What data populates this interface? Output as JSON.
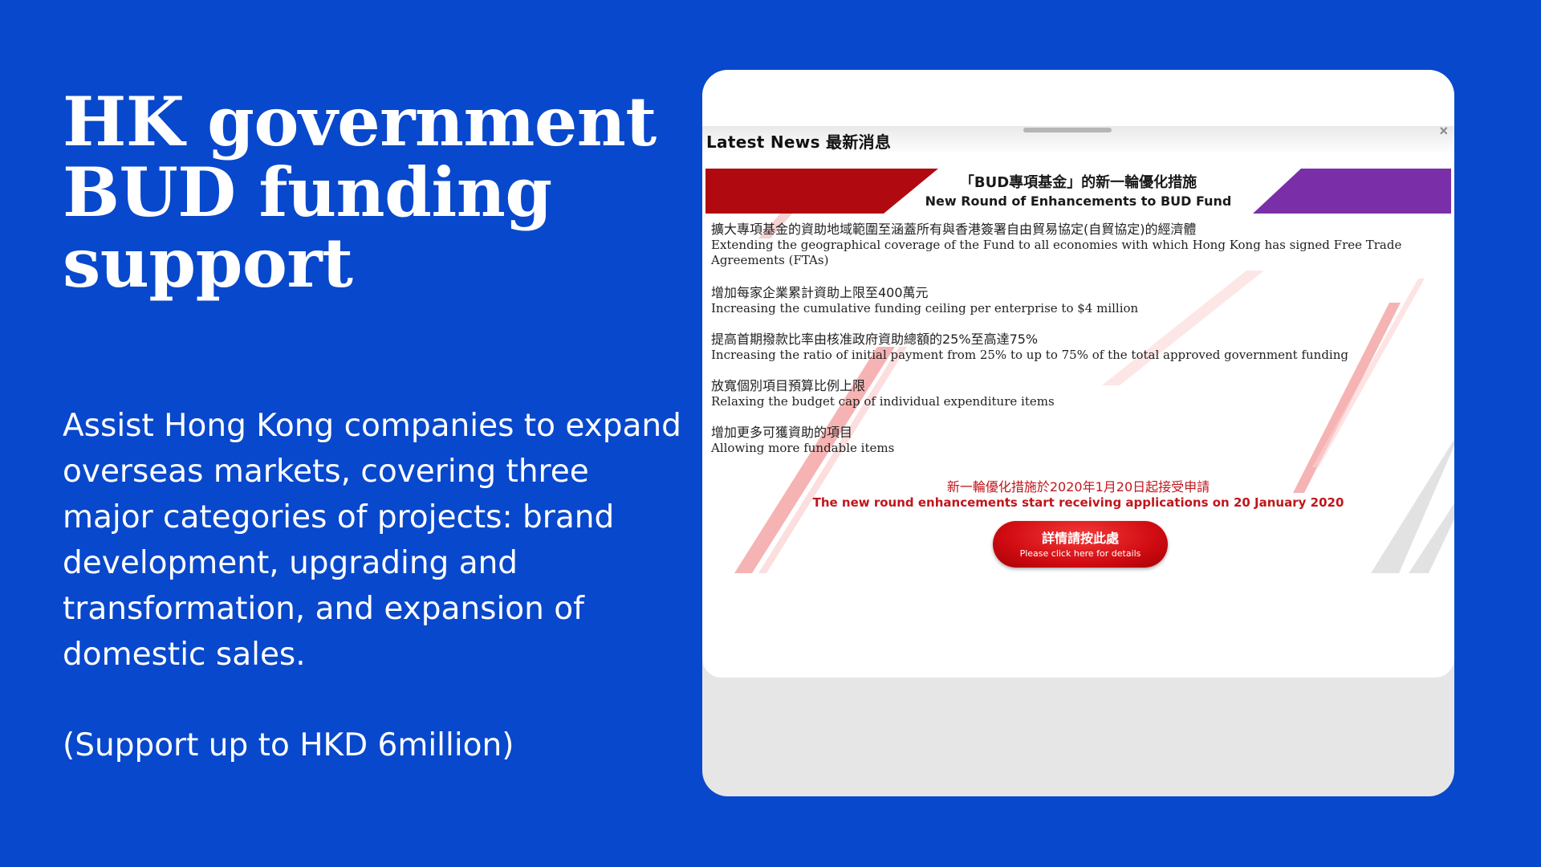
{
  "slide": {
    "title": "HK government BUD funding support",
    "description": "Assist Hong Kong companies to expand overseas markets, covering three major categories of projects: brand development, upgrading and transformation, and expansion of domestic sales.",
    "support": "(Support up to HKD 6million)"
  },
  "news_panel": {
    "heading": "Latest News 最新消息",
    "close_glyph": "×",
    "banner_zh": "「BUD專項基金」的新一輪優化措施",
    "banner_en": "New Round of Enhancements to BUD Fund",
    "items": [
      {
        "zh": "擴大專項基金的資助地域範圍至涵蓋所有與香港簽署自由貿易協定(自貿協定)的經濟體",
        "en": "Extending the geographical coverage of the Fund to all economies with which Hong Kong has signed Free Trade Agreements (FTAs)"
      },
      {
        "zh": "增加每家企業累計資助上限至400萬元",
        "en": "Increasing the cumulative funding ceiling per enterprise to $4 million"
      },
      {
        "zh": "提高首期撥款比率由核准政府資助總額的25%至高達75%",
        "en": "Increasing the ratio of initial  payment from 25% to up to 75% of the total approved government funding"
      },
      {
        "zh": "放寬個別項目預算比例上限",
        "en": "Relaxing the budget cap of individual expenditure items"
      },
      {
        "zh": "增加更多可獲資助的項目",
        "en": "Allowing more fundable items"
      }
    ],
    "notice_zh": "新一輪優化措施於2020年1月20日起接受申請",
    "notice_en": "The new round enhancements start receiving applications on 20 January 2020",
    "button_zh": "詳情請按此處",
    "button_en": "Please click here for details"
  },
  "colors": {
    "background": "#0848cc",
    "banner_red": "#b00a10",
    "banner_purple": "#7a2fa8",
    "notice_red": "#c0161c"
  }
}
